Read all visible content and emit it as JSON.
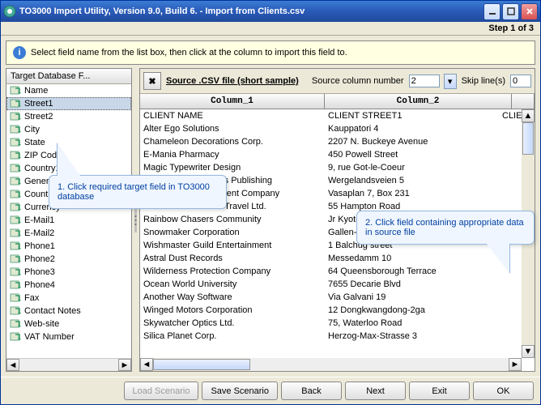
{
  "window": {
    "title": "TO3000 Import Utility, Version 9.0, Build 6. - Import from Clients.csv",
    "step": "Step 1 of 3"
  },
  "info": {
    "text": "Select field name from the list box, then click at the column to import this field to."
  },
  "left": {
    "header": "Target Database F...",
    "fields": [
      "Name",
      "Street1",
      "Street2",
      "City",
      "State",
      "ZIP Code",
      "Country1",
      "General Info",
      "Country",
      "Currency",
      "E-Mail1",
      "E-Mail2",
      "Phone1",
      "Phone2",
      "Phone3",
      "Phone4",
      "Fax",
      "Contact Notes",
      "Web-site",
      "VAT Number"
    ],
    "selected": 1
  },
  "right": {
    "source_label": "Source .CSV file (short sample)",
    "col_num_label": "Source column number",
    "col_num": "2",
    "skip_label": "Skip line(s)",
    "skip": "0",
    "columns": [
      "Column_1",
      "Column_2",
      ""
    ],
    "rows": [
      [
        "CLIENT NAME",
        "CLIENT STREET1",
        "CLIE"
      ],
      [
        "Alter Ego Solutions",
        "Kauppatori 4",
        ""
      ],
      [
        "Chameleon Decorations Corp.",
        "2207 N. Buckeye Avenue",
        ""
      ],
      [
        "E-Mania Pharmacy",
        "450 Powell Street",
        ""
      ],
      [
        "Magic Typewriter Design",
        "9, rue Got-le-Coeur",
        ""
      ],
      [
        "Moonlight Reflections Publishing",
        "Wergelandsveien 5",
        ""
      ],
      [
        "Mythology Development Company",
        "Vasaplan 7, Box 231",
        ""
      ],
      [
        "Parallel Dimensions Travel Ltd.",
        "55 Hampton Road",
        ""
      ],
      [
        "Rainbow Chasers Community",
        "Jr Kyoto 3120",
        ""
      ],
      [
        "Snowmaker Corporation",
        "Gallen-Kallelankatu 8",
        ""
      ],
      [
        "Wishmaster Guild Entertainment",
        "1 Balchug street",
        ""
      ],
      [
        "Astral Dust Records",
        "Messedamm 10",
        ""
      ],
      [
        "Wilderness Protection Company",
        "64 Queensborough Terrace",
        ""
      ],
      [
        "Ocean World University",
        "7655 Decarie Blvd",
        ""
      ],
      [
        "Another Way Software",
        "Via Galvani 19",
        ""
      ],
      [
        "Winged Motors Corporation",
        "12 Dongkwangdong-2ga",
        ""
      ],
      [
        "Skywatcher Optics Ltd.",
        "75, Waterloo Road",
        ""
      ],
      [
        "Silica Planet Corp.",
        "Herzog-Max-Strasse 3",
        ""
      ]
    ]
  },
  "buttons": {
    "load": "Load Scenario",
    "save": "Save Scenario",
    "back": "Back",
    "next": "Next",
    "exit": "Exit",
    "ok": "OK"
  },
  "callouts": {
    "c1": "1. Click required target field in TO3000 database",
    "c2": "2. Click field containing appropriate data in source file"
  }
}
